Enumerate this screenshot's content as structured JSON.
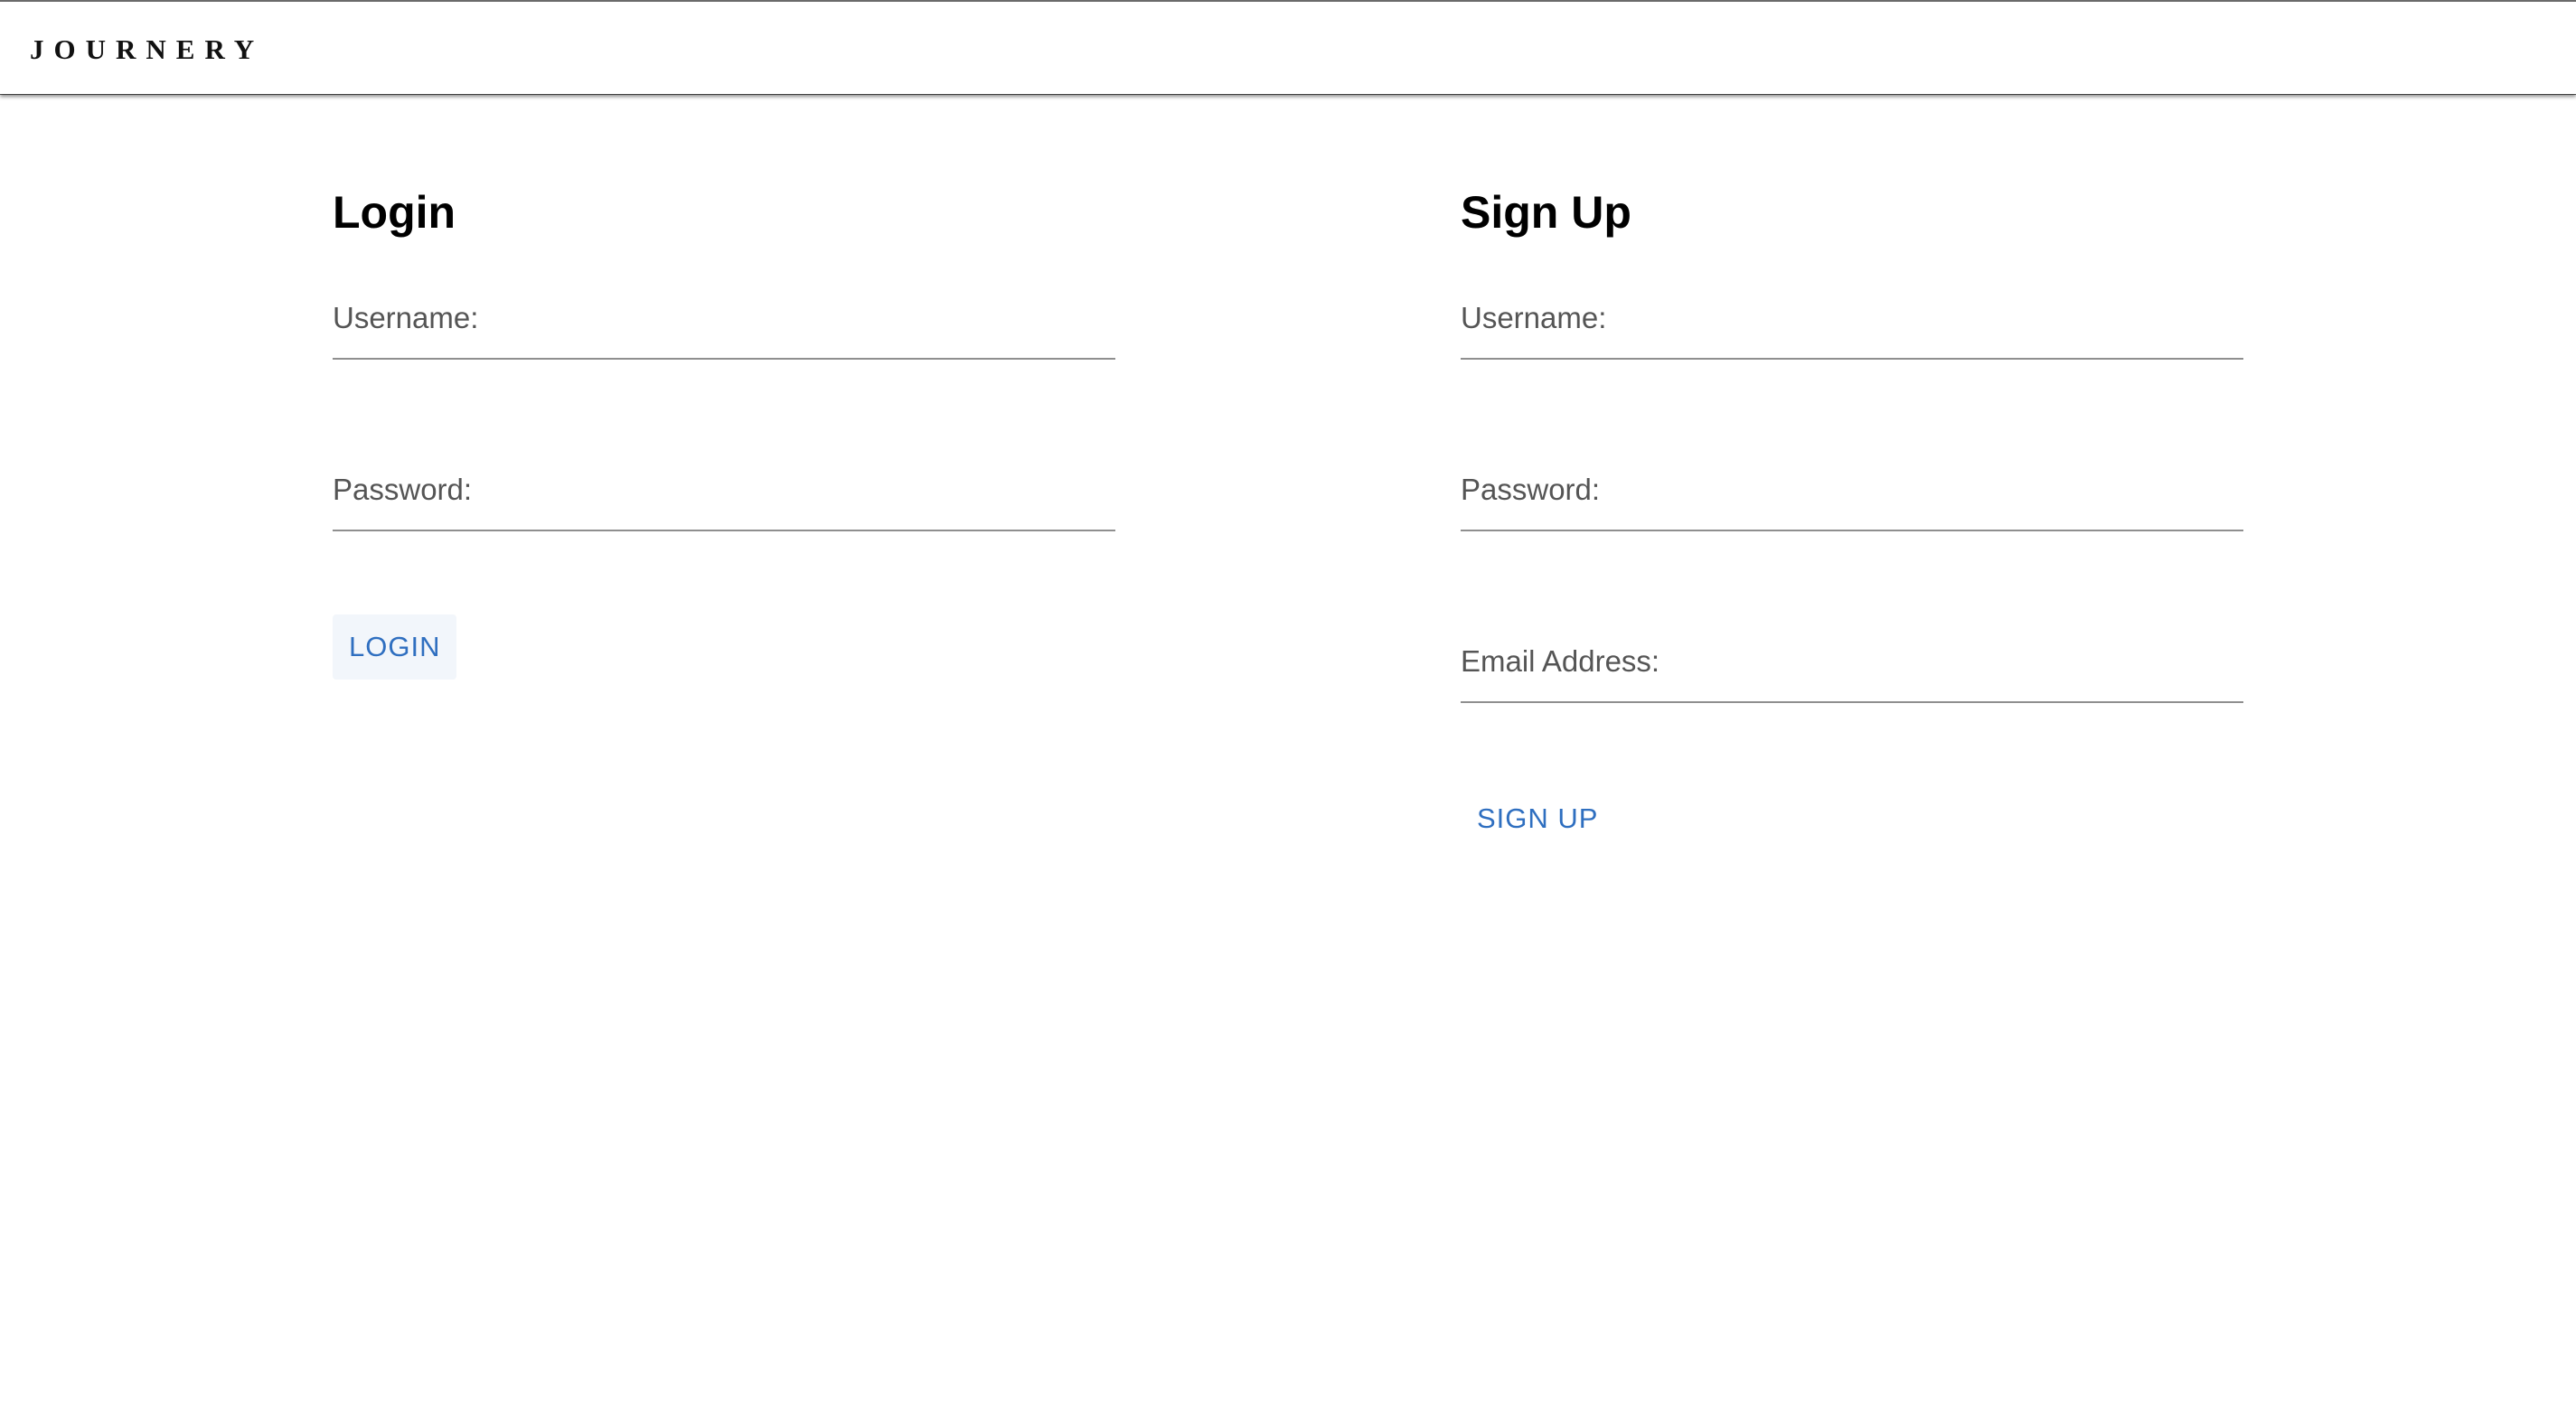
{
  "header": {
    "brand": "JOURNERY"
  },
  "login": {
    "title": "Login",
    "username_label": "Username:",
    "username_value": "",
    "password_label": "Password:",
    "password_value": "",
    "button_label": "LOGIN"
  },
  "signup": {
    "title": "Sign Up",
    "username_label": "Username:",
    "username_value": "",
    "password_label": "Password:",
    "password_value": "",
    "email_label": "Email Address:",
    "email_value": "",
    "button_label": "SIGN UP"
  },
  "colors": {
    "accent": "#2f6fc0",
    "label": "#555555",
    "underline": "#8f8f8f"
  }
}
